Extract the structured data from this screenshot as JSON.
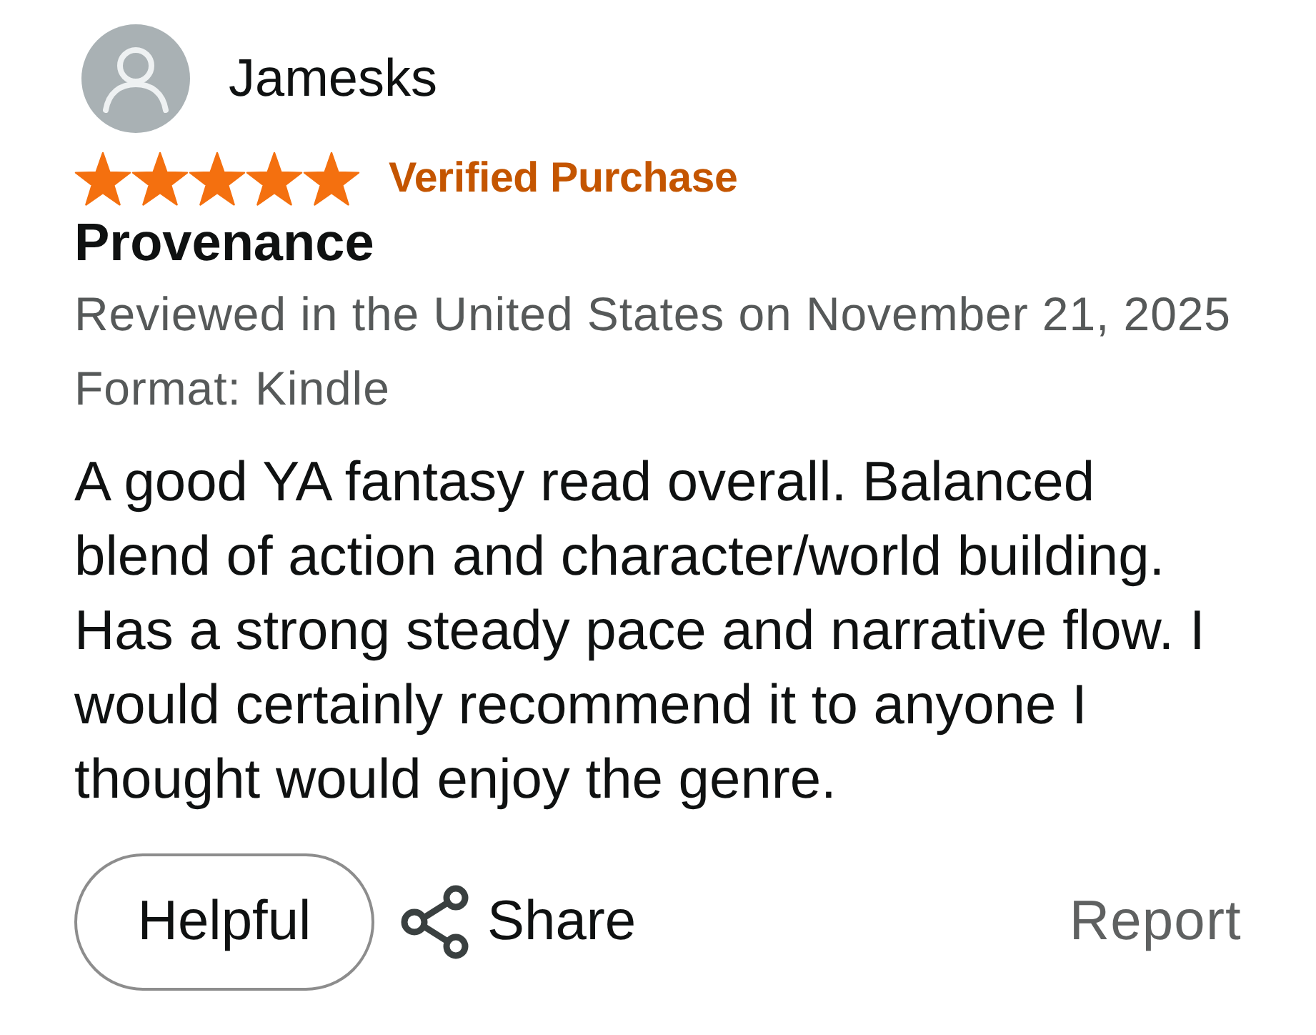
{
  "reviewer": {
    "name": "Jamesks"
  },
  "rating": {
    "stars": 5
  },
  "badge": "Verified Purchase",
  "title": "Provenance",
  "meta": [
    "Reviewed in the United States on November 21, 2025",
    "Format: Kindle"
  ],
  "body": "A good YA fantasy read overall. Balanced blend of action and character/world building. Has a strong steady pace and narrative flow. I would certainly recommend it to anyone I thought would enjoy the genre.",
  "actions": [
    {
      "kind": "pill",
      "label": "Helpful"
    },
    {
      "kind": "share",
      "label": "Share"
    },
    {
      "kind": "link",
      "label": "Report"
    }
  ]
}
